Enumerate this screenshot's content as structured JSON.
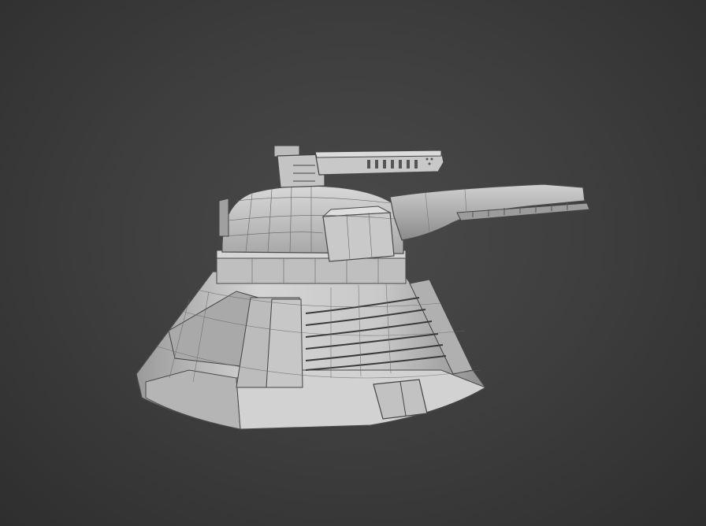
{
  "viewport": {
    "background": "#3f3f3f",
    "shading": "grey-clay",
    "wireframe": "edged-faces"
  },
  "model": {
    "kind": "turret",
    "parts": [
      "base",
      "dome",
      "main-barrel",
      "secondary-cannon"
    ],
    "mesh_color": "#bdbdbd",
    "wire_color": "#555555"
  }
}
